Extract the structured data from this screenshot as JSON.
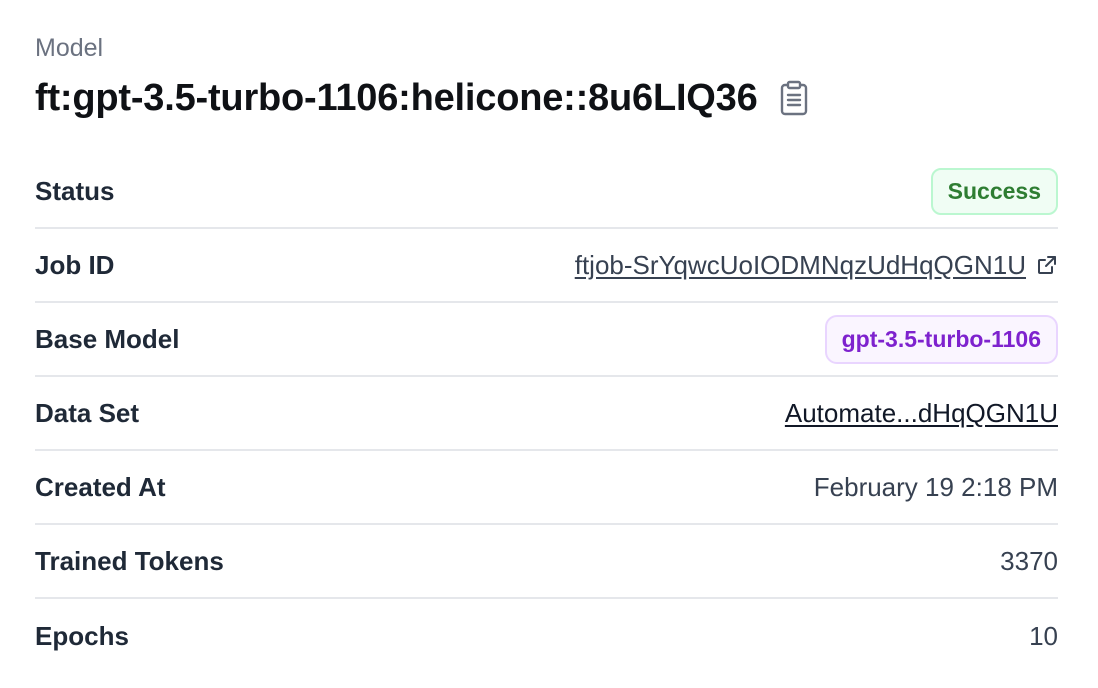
{
  "header": {
    "label": "Model",
    "title": "ft:gpt-3.5-turbo-1106:helicone::8u6LIQ36",
    "copy_icon": "clipboard-icon"
  },
  "rows": {
    "status": {
      "label": "Status",
      "value": "Success"
    },
    "job_id": {
      "label": "Job ID",
      "value": "ftjob-SrYqwcUoIODMNqzUdHqQGN1U",
      "icon": "external-link-icon"
    },
    "base_model": {
      "label": "Base Model",
      "value": "gpt-3.5-turbo-1106"
    },
    "data_set": {
      "label": "Data Set",
      "value": "Automate...dHqQGN1U"
    },
    "created_at": {
      "label": "Created At",
      "value": "February 19 2:18 PM"
    },
    "trained_tokens": {
      "label": "Trained Tokens",
      "value": "3370"
    },
    "epochs": {
      "label": "Epochs",
      "value": "10"
    }
  },
  "colors": {
    "success_text": "#2e7d32",
    "success_bg": "#f0fdf4",
    "purple_text": "#7e22ce",
    "purple_bg": "#faf5ff",
    "divider": "#e5e7eb"
  }
}
